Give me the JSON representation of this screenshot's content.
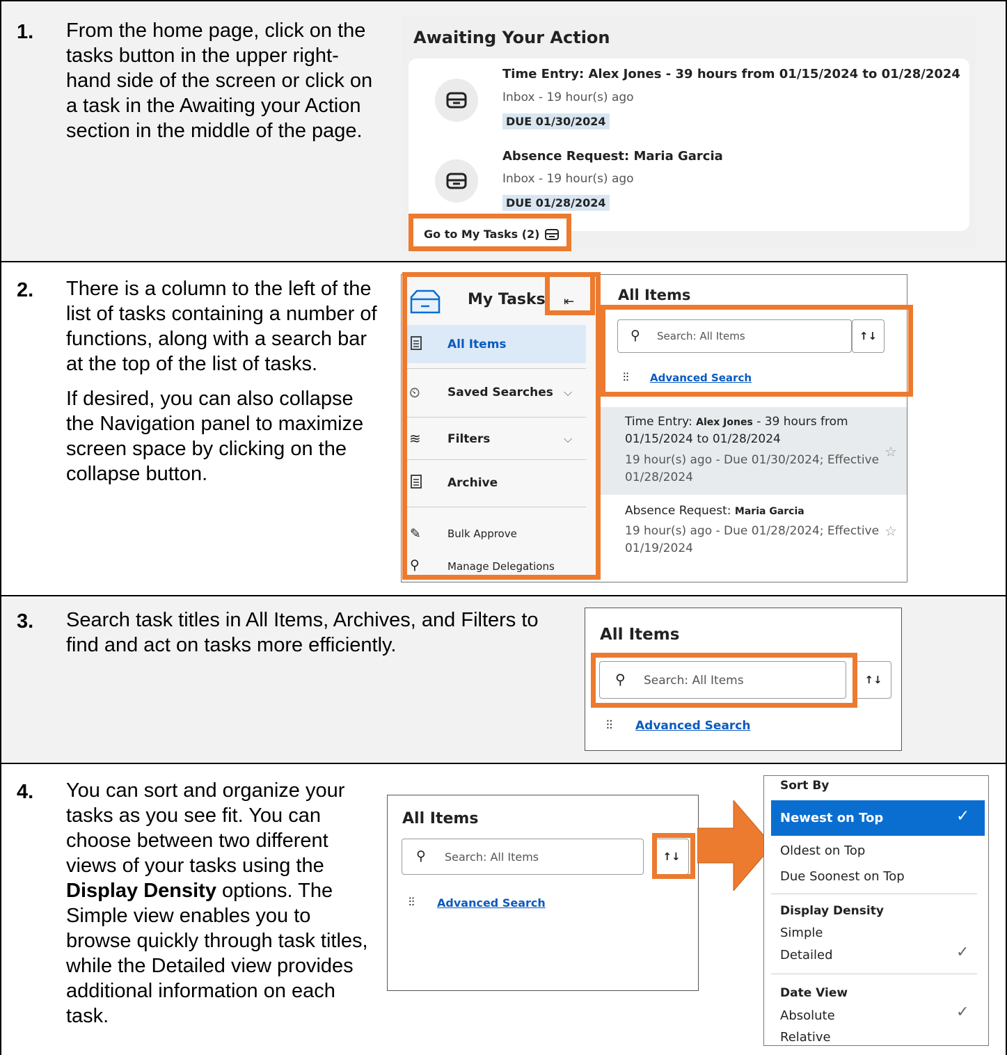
{
  "steps": [
    {
      "number": "1.",
      "text": "From the home page, click on the tasks button in the upper right-hand side of the screen or click on a task in the Awaiting your Action section in the middle of the page.",
      "screenshot": {
        "title": "Awaiting Your Action",
        "tasks": [
          {
            "type": "Time Entry:",
            "name": "Alex Jones",
            "detail": "- 39 hours from 01/15/2024 to 01/28/2024",
            "meta": "Inbox - 19 hour(s) ago",
            "due": "DUE 01/30/2024"
          },
          {
            "type": "Absence Request:",
            "name": "Maria Garcia",
            "detail": "",
            "meta": "Inbox - 19 hour(s) ago",
            "due": "DUE 01/28/2024"
          }
        ],
        "go_to_tasks": "Go to My Tasks (2)"
      }
    },
    {
      "number": "2.",
      "text_a": "There is a column to the left of the list of tasks containing a number of functions, along with a search bar at the top of the list of tasks.",
      "text_b": "If desired, you can also collapse the Navigation panel to maximize screen space by clicking on the collapse button.",
      "screenshot": {
        "nav_title": "My Tasks",
        "nav_items": [
          "All Items",
          "Saved Searches",
          "Filters",
          "Archive",
          "Bulk Approve",
          "Manage Delegations"
        ],
        "list_title": "All Items",
        "search_placeholder": "Search: All Items",
        "advanced_search": "Advanced Search",
        "tasks": [
          {
            "type": "Time Entry:",
            "name": "Alex Jones",
            "line1_rest": "- 39 hours from",
            "line2": "01/15/2024 to 01/28/2024",
            "line3": "19 hour(s) ago - Due 01/30/2024; Effective",
            "line4": "01/28/2024"
          },
          {
            "type": "Absence Request:",
            "name": "Maria Garcia",
            "line3": "19 hour(s) ago - Due 01/28/2024; Effective",
            "line4": "01/19/2024"
          }
        ]
      }
    },
    {
      "number": "3.",
      "text": "Search task titles in All Items, Archives, and Filters to find and act on tasks more efficiently.",
      "screenshot": {
        "title": "All Items",
        "search_placeholder": "Search: All Items",
        "advanced_search": "Advanced Search"
      }
    },
    {
      "number": "4.",
      "text_pre": "You can sort and organize your tasks as you see fit. You can choose between two different views of your tasks using the",
      "text_bold": "Display Density",
      "text_post": "options. The Simple view enables you to browse quickly through task titles, while the Detailed view provides additional information on each task.",
      "screenshot": {
        "title": "All Items",
        "search_placeholder": "Search: All Items",
        "advanced_search": "Advanced Search",
        "menu": {
          "sort_by": "Sort By",
          "sort_options": [
            "Newest on Top",
            "Oldest on Top",
            "Due Soonest on Top"
          ],
          "density_header": "Display Density",
          "density_options": [
            "Simple",
            "Detailed"
          ],
          "date_header": "Date View",
          "date_options": [
            "Absolute",
            "Relative"
          ]
        }
      }
    }
  ],
  "colors": {
    "highlight": "#ec7a2f",
    "selected": "#0a6ed1",
    "link": "#0a5bbf"
  }
}
